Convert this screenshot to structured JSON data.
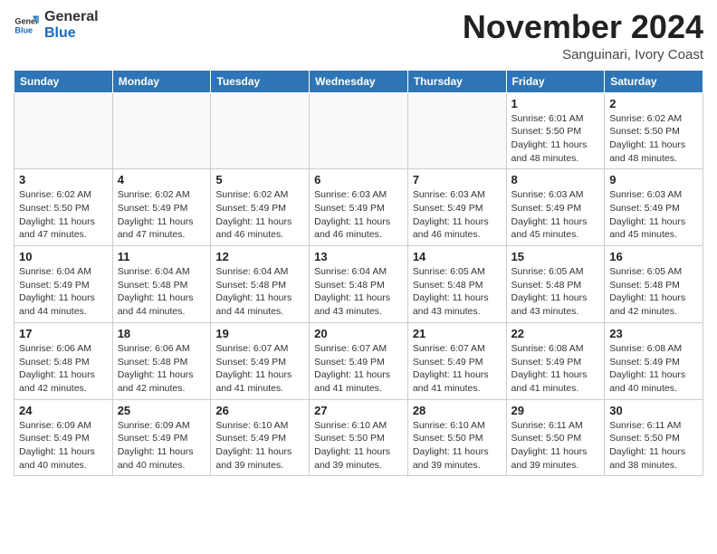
{
  "header": {
    "logo_line1": "General",
    "logo_line2": "Blue",
    "month_title": "November 2024",
    "location": "Sanguinari, Ivory Coast"
  },
  "weekdays": [
    "Sunday",
    "Monday",
    "Tuesday",
    "Wednesday",
    "Thursday",
    "Friday",
    "Saturday"
  ],
  "weeks": [
    [
      {
        "day": "",
        "info": ""
      },
      {
        "day": "",
        "info": ""
      },
      {
        "day": "",
        "info": ""
      },
      {
        "day": "",
        "info": ""
      },
      {
        "day": "",
        "info": ""
      },
      {
        "day": "1",
        "info": "Sunrise: 6:01 AM\nSunset: 5:50 PM\nDaylight: 11 hours and 48 minutes."
      },
      {
        "day": "2",
        "info": "Sunrise: 6:02 AM\nSunset: 5:50 PM\nDaylight: 11 hours and 48 minutes."
      }
    ],
    [
      {
        "day": "3",
        "info": "Sunrise: 6:02 AM\nSunset: 5:50 PM\nDaylight: 11 hours and 47 minutes."
      },
      {
        "day": "4",
        "info": "Sunrise: 6:02 AM\nSunset: 5:49 PM\nDaylight: 11 hours and 47 minutes."
      },
      {
        "day": "5",
        "info": "Sunrise: 6:02 AM\nSunset: 5:49 PM\nDaylight: 11 hours and 46 minutes."
      },
      {
        "day": "6",
        "info": "Sunrise: 6:03 AM\nSunset: 5:49 PM\nDaylight: 11 hours and 46 minutes."
      },
      {
        "day": "7",
        "info": "Sunrise: 6:03 AM\nSunset: 5:49 PM\nDaylight: 11 hours and 46 minutes."
      },
      {
        "day": "8",
        "info": "Sunrise: 6:03 AM\nSunset: 5:49 PM\nDaylight: 11 hours and 45 minutes."
      },
      {
        "day": "9",
        "info": "Sunrise: 6:03 AM\nSunset: 5:49 PM\nDaylight: 11 hours and 45 minutes."
      }
    ],
    [
      {
        "day": "10",
        "info": "Sunrise: 6:04 AM\nSunset: 5:49 PM\nDaylight: 11 hours and 44 minutes."
      },
      {
        "day": "11",
        "info": "Sunrise: 6:04 AM\nSunset: 5:48 PM\nDaylight: 11 hours and 44 minutes."
      },
      {
        "day": "12",
        "info": "Sunrise: 6:04 AM\nSunset: 5:48 PM\nDaylight: 11 hours and 44 minutes."
      },
      {
        "day": "13",
        "info": "Sunrise: 6:04 AM\nSunset: 5:48 PM\nDaylight: 11 hours and 43 minutes."
      },
      {
        "day": "14",
        "info": "Sunrise: 6:05 AM\nSunset: 5:48 PM\nDaylight: 11 hours and 43 minutes."
      },
      {
        "day": "15",
        "info": "Sunrise: 6:05 AM\nSunset: 5:48 PM\nDaylight: 11 hours and 43 minutes."
      },
      {
        "day": "16",
        "info": "Sunrise: 6:05 AM\nSunset: 5:48 PM\nDaylight: 11 hours and 42 minutes."
      }
    ],
    [
      {
        "day": "17",
        "info": "Sunrise: 6:06 AM\nSunset: 5:48 PM\nDaylight: 11 hours and 42 minutes."
      },
      {
        "day": "18",
        "info": "Sunrise: 6:06 AM\nSunset: 5:48 PM\nDaylight: 11 hours and 42 minutes."
      },
      {
        "day": "19",
        "info": "Sunrise: 6:07 AM\nSunset: 5:49 PM\nDaylight: 11 hours and 41 minutes."
      },
      {
        "day": "20",
        "info": "Sunrise: 6:07 AM\nSunset: 5:49 PM\nDaylight: 11 hours and 41 minutes."
      },
      {
        "day": "21",
        "info": "Sunrise: 6:07 AM\nSunset: 5:49 PM\nDaylight: 11 hours and 41 minutes."
      },
      {
        "day": "22",
        "info": "Sunrise: 6:08 AM\nSunset: 5:49 PM\nDaylight: 11 hours and 41 minutes."
      },
      {
        "day": "23",
        "info": "Sunrise: 6:08 AM\nSunset: 5:49 PM\nDaylight: 11 hours and 40 minutes."
      }
    ],
    [
      {
        "day": "24",
        "info": "Sunrise: 6:09 AM\nSunset: 5:49 PM\nDaylight: 11 hours and 40 minutes."
      },
      {
        "day": "25",
        "info": "Sunrise: 6:09 AM\nSunset: 5:49 PM\nDaylight: 11 hours and 40 minutes."
      },
      {
        "day": "26",
        "info": "Sunrise: 6:10 AM\nSunset: 5:49 PM\nDaylight: 11 hours and 39 minutes."
      },
      {
        "day": "27",
        "info": "Sunrise: 6:10 AM\nSunset: 5:50 PM\nDaylight: 11 hours and 39 minutes."
      },
      {
        "day": "28",
        "info": "Sunrise: 6:10 AM\nSunset: 5:50 PM\nDaylight: 11 hours and 39 minutes."
      },
      {
        "day": "29",
        "info": "Sunrise: 6:11 AM\nSunset: 5:50 PM\nDaylight: 11 hours and 39 minutes."
      },
      {
        "day": "30",
        "info": "Sunrise: 6:11 AM\nSunset: 5:50 PM\nDaylight: 11 hours and 38 minutes."
      }
    ]
  ]
}
